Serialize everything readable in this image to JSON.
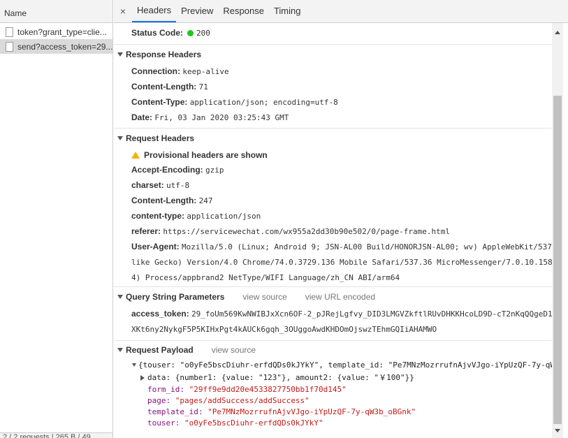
{
  "requests": {
    "header": "Name",
    "items": [
      {
        "name": "token?grant_type=clie..."
      },
      {
        "name": "send?access_token=29..."
      }
    ],
    "footer": "2 / 2 requests | 265 B / 49..."
  },
  "tabs": {
    "close": "×",
    "items": [
      "Headers",
      "Preview",
      "Response",
      "Timing"
    ]
  },
  "general": {
    "status_label": "Status Code:",
    "status_value": "200",
    "status_color": "#1ec71e"
  },
  "response_headers": {
    "title": "Response Headers",
    "rows": [
      {
        "k": "Connection:",
        "v": "keep-alive"
      },
      {
        "k": "Content-Length:",
        "v": "71"
      },
      {
        "k": "Content-Type:",
        "v": "application/json; encoding=utf-8"
      },
      {
        "k": "Date:",
        "v": "Fri, 03 Jan 2020 03:25:43 GMT"
      }
    ]
  },
  "request_headers": {
    "title": "Request Headers",
    "warning": "Provisional headers are shown",
    "rows": [
      {
        "k": "Accept-Encoding:",
        "v": "gzip"
      },
      {
        "k": "charset:",
        "v": "utf-8"
      },
      {
        "k": "Content-Length:",
        "v": "247"
      },
      {
        "k": "content-type:",
        "v": "application/json"
      },
      {
        "k": "referer:",
        "v": "https://servicewechat.com/wx955a2dd30b90e502/0/page-frame.html"
      },
      {
        "k": "User-Agent:",
        "v": "Mozilla/5.0 (Linux; Android 9; JSN-AL00 Build/HONORJSN-AL00; wv) AppleWebKit/537"
      }
    ],
    "ua_cont1": "like Gecko) Version/4.0 Chrome/74.0.3729.136 Mobile Safari/537.36 MicroMessenger/7.0.10.158",
    "ua_cont2": "4) Process/appbrand2 NetType/WIFI Language/zh_CN ABI/arm64"
  },
  "query_params": {
    "title": "Query String Parameters",
    "view_source": "view source",
    "view_url_encoded": "view URL encoded",
    "key": "access_token:",
    "value_line1": "29_foUm569KwNWIBJxXcn6OF-2_pJRejLgfvy_DID3LMGVZkftlRUvDHKKHcoLD9D-cT2nKqQQgeD1k",
    "value_line2": "XKt6ny2NykgF5P5KIHxPgt4kAUCk6gqh_3OUggoAwdKHDOmOjswzTEhmGQIiAHAMWO"
  },
  "payload": {
    "title": "Request Payload",
    "view_source": "view source",
    "summary": "{touser: \"o0yFe5bscDiuhr-erfdQDs0kJYkY\", template_id: \"Pe7MNzMozrrufnAjvVJgo-iYpUzQF-7y-qW",
    "data_line": "data: {number1: {value: \"123\"}, amount2: {value: \"￥100\"}}",
    "fields": [
      {
        "k": "form_id:",
        "v": "\"29ff9e9dd20e4533827750bb1f70d145\""
      },
      {
        "k": "page:",
        "v": "\"pages/addSuccess/addSuccess\""
      },
      {
        "k": "template_id:",
        "v": "\"Pe7MNzMozrrufnAjvVJgo-iYpUzQF-7y-qW3b_oBGnk\""
      },
      {
        "k": "touser:",
        "v": "\"o0yFe5bscDiuhr-erfdQDs0kJYkY\""
      }
    ]
  }
}
